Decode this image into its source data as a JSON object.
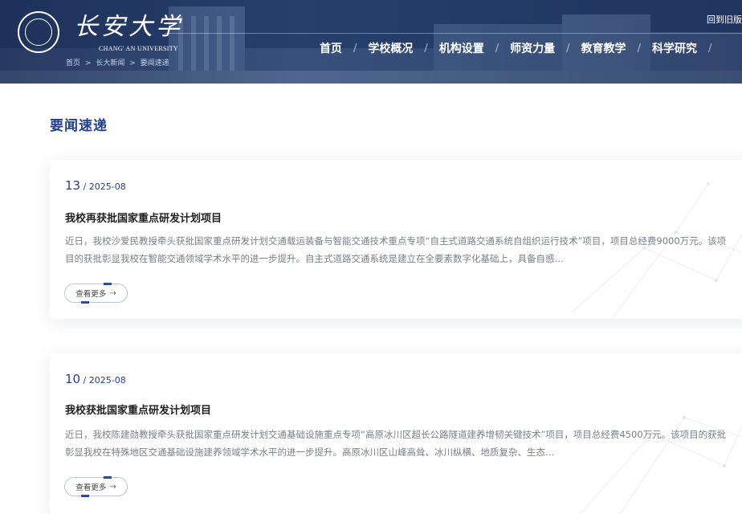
{
  "header": {
    "logo_cn": "长安大学",
    "logo_en": "CHANG' AN UNIVERSITY",
    "old_version_link": "回到旧版",
    "breadcrumb": [
      "首页",
      ">",
      "长大新闻",
      ">",
      "要闻速递"
    ],
    "nav": [
      "首页",
      "学校概况",
      "机构设置",
      "师资力量",
      "教育教学",
      "科学研究"
    ],
    "nav_separator": "/"
  },
  "page": {
    "title": "要闻速递"
  },
  "articles": [
    {
      "day": "13",
      "year_month": " / 2025-08",
      "title": "我校再获批国家重点研发计划项目",
      "summary": "近日，我校沙爱民教授牵头获批国家重点研发计划交通载运装备与智能交通技术重点专项“自主式道路交通系统自组织运行技术”项目，项目总经费9000万元。该项目的获批彰显我校在智能交通领域学术水平的进一步提升。自主式道路交通系统是建立在全要素数字化基础上，具备自感…",
      "more_label": "查看更多",
      "more_arrow": "→"
    },
    {
      "day": "10",
      "year_month": " / 2025-08",
      "title": "我校获批国家重点研发计划项目",
      "summary": "近日，我校陈建勋教授牵头获批国家重点研发计划交通基础设施重点专项“高原冰川区超长公路隧道建养增韧关键技术”项目，项目总经费4500万元。该项目的获批彰显我校在特殊地区交通基础设施建养领域学术水平的进一步提升。高原冰川区山峰高耸、冰川纵横、地质复杂、生态…",
      "more_label": "查看更多",
      "more_arrow": "→"
    }
  ]
}
